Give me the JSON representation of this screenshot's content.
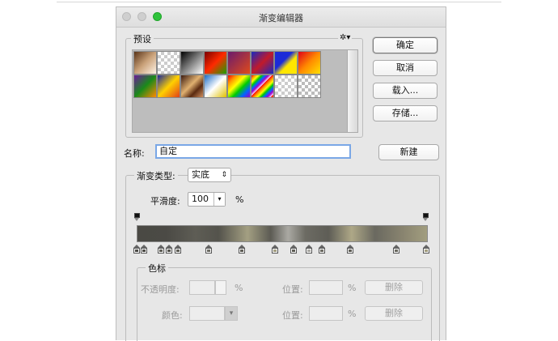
{
  "window": {
    "title": "渐变编辑器"
  },
  "presets": {
    "label": "预设",
    "gear_glyph": "✲▾"
  },
  "buttons": {
    "ok": "确定",
    "cancel": "取消",
    "load": "载入...",
    "save": "存储...",
    "new": "新建"
  },
  "name": {
    "label": "名称:",
    "value": "自定"
  },
  "gradient_type": {
    "label": "渐变类型:",
    "value": "实底",
    "arrow": "⇕"
  },
  "smoothness": {
    "label": "平滑度:",
    "value": "100",
    "unit": "%",
    "arrow": "▾"
  },
  "color_stops_panel": {
    "label": "色标",
    "opacity_label": "不透明度:",
    "opacity_unit": "%",
    "position_label_1": "位置:",
    "position_unit_1": "%",
    "delete_1": "删除",
    "color_label": "颜色:",
    "color_arrow": "▾",
    "position_label_2": "位置:",
    "position_unit_2": "%",
    "delete_2": "删除"
  },
  "colors": {
    "accent": "#2fc33b",
    "focus_ring": "#7aa7e6"
  }
}
